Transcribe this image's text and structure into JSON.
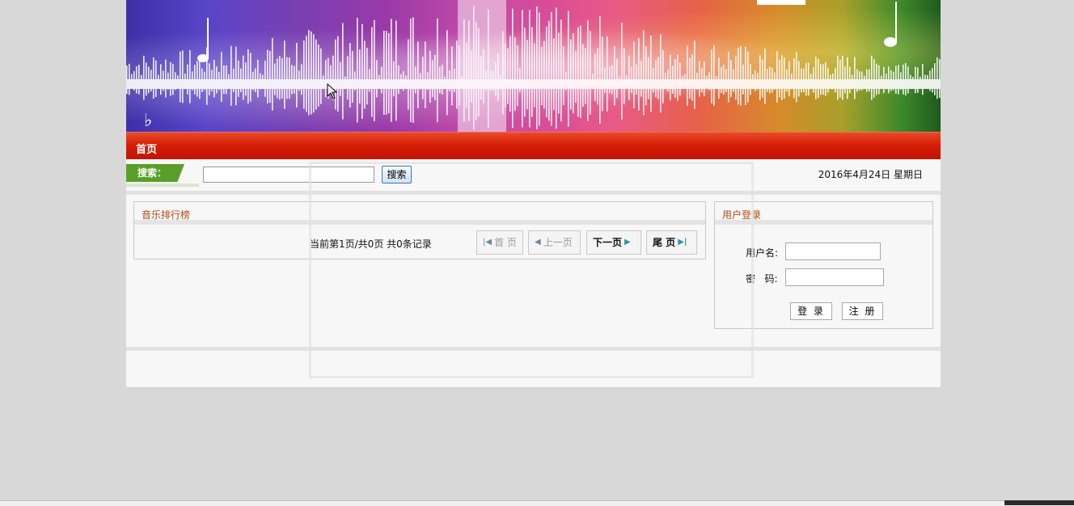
{
  "nav": {
    "home_label": "首页"
  },
  "search": {
    "tag_label": "搜索：",
    "button_label": "搜索",
    "value": ""
  },
  "date_text": "2016年4月24日 星期日",
  "ranking": {
    "title": "音乐排行榜",
    "pager_text": "当前第1页/共0页  共0条记录",
    "first_label": "首 页",
    "prev_label": "上一页",
    "next_label": "下一页",
    "last_label": "尾 页"
  },
  "login": {
    "title": "用户登录",
    "username_label": "用户名:",
    "password_label": "密   码:",
    "login_button": "登 录",
    "register_button": "注 册"
  },
  "colors": {
    "nav_red": "#d41e06",
    "title_orange": "#b24a12",
    "tag_green": "#5a9e2a"
  }
}
